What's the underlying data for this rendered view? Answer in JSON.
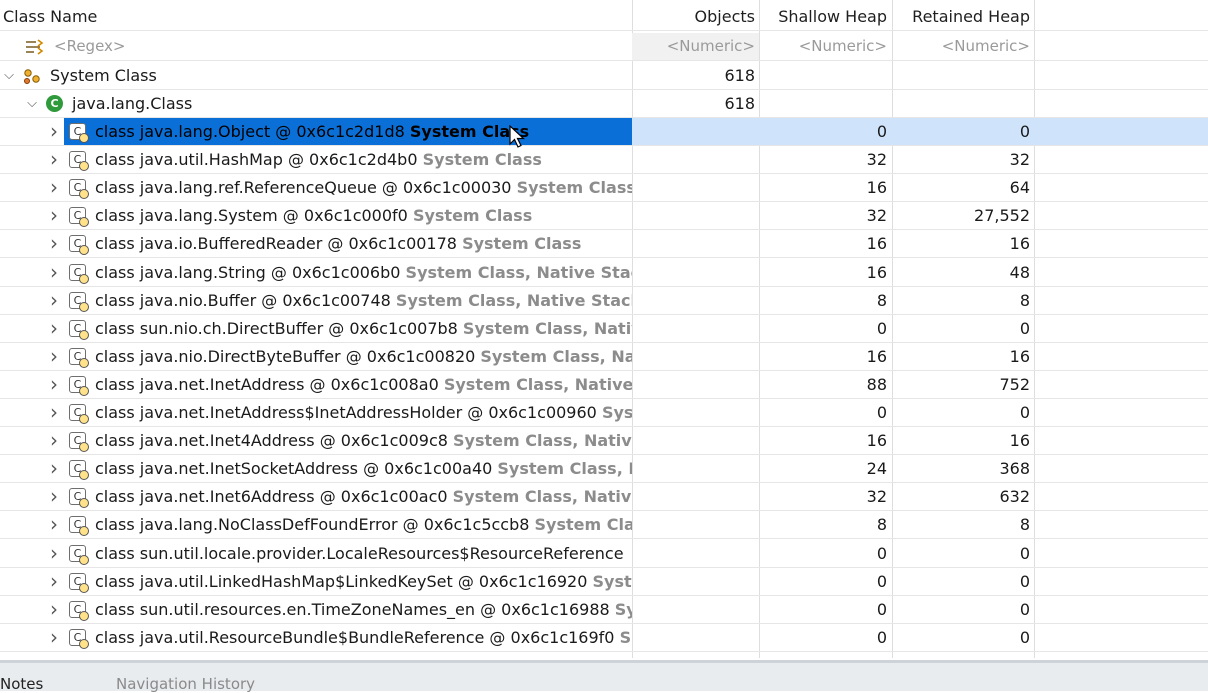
{
  "columns": {
    "class_name": "Class Name",
    "objects": "Objects",
    "shallow_heap": "Shallow Heap",
    "retained_heap": "Retained Heap"
  },
  "filter": {
    "regex": "<Regex>",
    "objects": "<Numeric>",
    "shallow": "<Numeric>",
    "retained": "<Numeric>"
  },
  "group": {
    "label": "System Class",
    "objects": "618"
  },
  "subgroup": {
    "label": "java.lang.Class",
    "objects": "618",
    "icon_letter": "C"
  },
  "rows": [
    {
      "name": "class java.lang.Object @ 0x6c1c2d1d8",
      "attrs": "System Class",
      "shallow": "0",
      "retained": "0"
    },
    {
      "name": "class java.util.HashMap @ 0x6c1c2d4b0",
      "attrs": "System Class",
      "shallow": "32",
      "retained": "32"
    },
    {
      "name": "class java.lang.ref.ReferenceQueue @ 0x6c1c00030",
      "attrs": "System Class",
      "shallow": "16",
      "retained": "64"
    },
    {
      "name": "class java.lang.System @ 0x6c1c000f0",
      "attrs": "System Class",
      "shallow": "32",
      "retained": "27,552"
    },
    {
      "name": "class java.io.BufferedReader @ 0x6c1c00178",
      "attrs": "System Class",
      "shallow": "16",
      "retained": "16"
    },
    {
      "name": "class java.lang.String @ 0x6c1c006b0",
      "attrs": "System Class, Native Stack",
      "shallow": "16",
      "retained": "48"
    },
    {
      "name": "class java.nio.Buffer @ 0x6c1c00748",
      "attrs": "System Class, Native Stack",
      "shallow": "8",
      "retained": "8"
    },
    {
      "name": "class sun.nio.ch.DirectBuffer @ 0x6c1c007b8",
      "attrs": "System Class, Nativ",
      "shallow": "0",
      "retained": "0"
    },
    {
      "name": "class java.nio.DirectByteBuffer @ 0x6c1c00820",
      "attrs": "System Class, Nat",
      "shallow": "16",
      "retained": "16"
    },
    {
      "name": "class java.net.InetAddress @ 0x6c1c008a0",
      "attrs": "System Class, Native S",
      "shallow": "88",
      "retained": "752"
    },
    {
      "name": "class java.net.InetAddress$InetAddressHolder @ 0x6c1c00960",
      "attrs": "Sys",
      "shallow": "0",
      "retained": "0"
    },
    {
      "name": "class java.net.Inet4Address @ 0x6c1c009c8",
      "attrs": "System Class, Native",
      "shallow": "16",
      "retained": "16"
    },
    {
      "name": "class java.net.InetSocketAddress @ 0x6c1c00a40",
      "attrs": "System Class, N",
      "shallow": "24",
      "retained": "368"
    },
    {
      "name": "class java.net.Inet6Address @ 0x6c1c00ac0",
      "attrs": "System Class, Native",
      "shallow": "32",
      "retained": "632"
    },
    {
      "name": "class java.lang.NoClassDefFoundError @ 0x6c1c5ccb8",
      "attrs": "System Cla",
      "shallow": "8",
      "retained": "8"
    },
    {
      "name": "class sun.util.locale.provider.LocaleResources$ResourceReference",
      "attrs": "",
      "shallow": "0",
      "retained": "0"
    },
    {
      "name": "class java.util.LinkedHashMap$LinkedKeySet @ 0x6c1c16920",
      "attrs": "Syst",
      "shallow": "0",
      "retained": "0"
    },
    {
      "name": "class sun.util.resources.en.TimeZoneNames_en @ 0x6c1c16988",
      "attrs": "Sy",
      "shallow": "0",
      "retained": "0"
    },
    {
      "name": "class java.util.ResourceBundle$BundleReference @ 0x6c1c169f0",
      "attrs": "S",
      "shallow": "0",
      "retained": "0"
    }
  ],
  "bottom_tabs": {
    "notes": "Notes",
    "navigation": "Navigation History"
  },
  "colors": {
    "selection": "#0a70d8",
    "selection_light": "#cfe4fb",
    "system_text": "#8c8c8c"
  }
}
